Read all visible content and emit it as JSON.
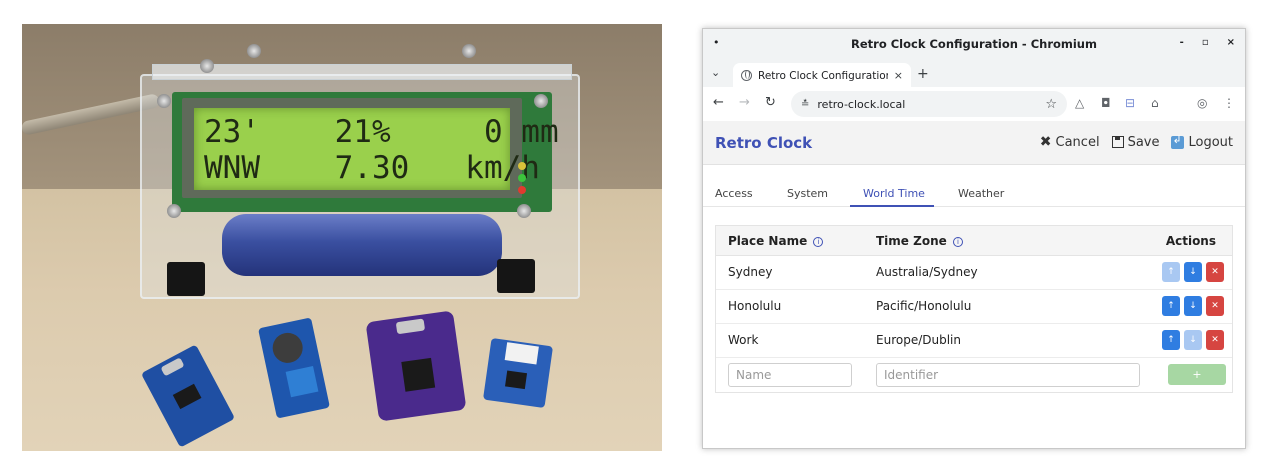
{
  "photo": {
    "lcd_line1": "23'    21%     0 mm",
    "lcd_line2": "WNW    7.30   km/h"
  },
  "browser": {
    "window_title": "Retro Clock Configuration - Chromium",
    "tab_title": "Retro Clock Configuration",
    "url": "retro-clock.local"
  },
  "app": {
    "brand": "Retro Clock",
    "actions": {
      "cancel": "Cancel",
      "save": "Save",
      "logout": "Logout"
    },
    "tabs": [
      "Access",
      "System",
      "World Time",
      "Weather"
    ],
    "active_tab": "World Time",
    "table": {
      "headers": {
        "place": "Place Name",
        "zone": "Time Zone",
        "actions": "Actions"
      },
      "rows": [
        {
          "place": "Sydney",
          "zone": "Australia/Sydney",
          "up_enabled": false,
          "down_enabled": true
        },
        {
          "place": "Honolulu",
          "zone": "Pacific/Honolulu",
          "up_enabled": true,
          "down_enabled": true
        },
        {
          "place": "Work",
          "zone": "Europe/Dublin",
          "up_enabled": true,
          "down_enabled": false
        }
      ],
      "new_row": {
        "name_placeholder": "Name",
        "zone_placeholder": "Identifier",
        "add_label": "+"
      }
    }
  }
}
